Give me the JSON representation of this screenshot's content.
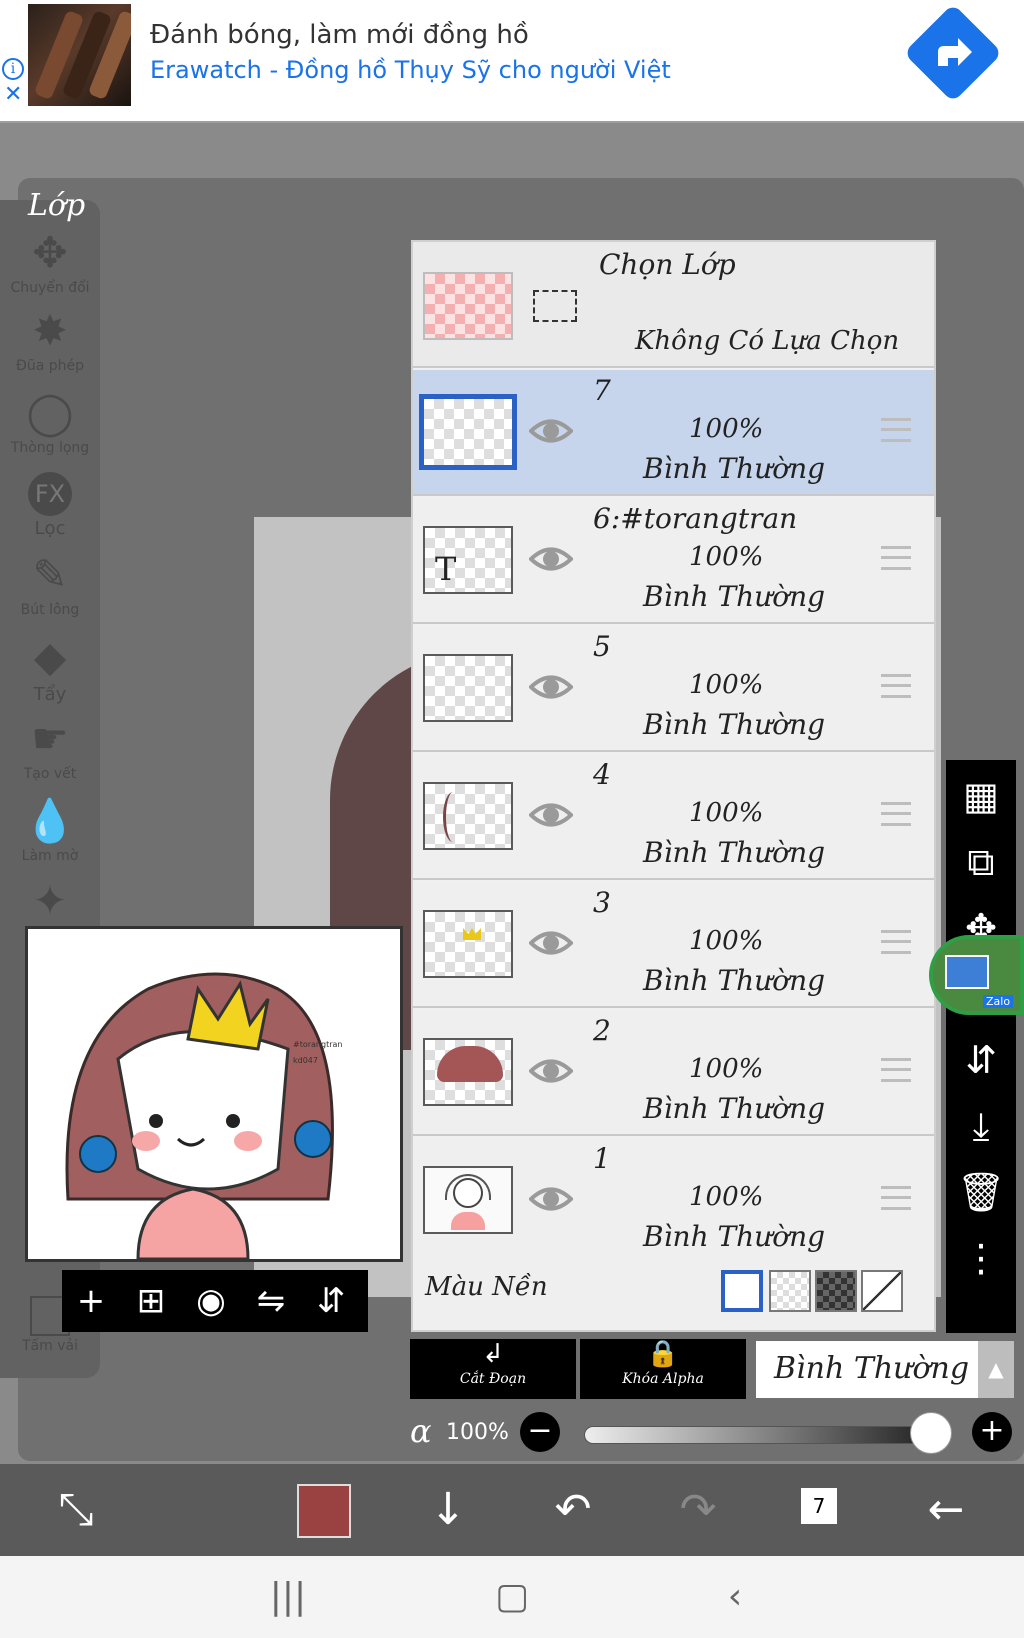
{
  "ad": {
    "title": "Đánh bóng, làm mới đồng hồ",
    "subtitle": "Erawatch - Đồng hồ Thụy Sỹ cho người Việt"
  },
  "toolbar": {
    "title": "Lớp",
    "tools": [
      {
        "label": "Chuyển đổi",
        "icon": "move-icon"
      },
      {
        "label": "Đũa phép",
        "icon": "magic-wand-icon"
      },
      {
        "label": "Thòng lọng",
        "icon": "lasso-icon"
      },
      {
        "label": "Lọc",
        "icon": "fx-icon"
      },
      {
        "label": "Bút lông",
        "icon": "brush-icon"
      },
      {
        "label": "Tẩy",
        "icon": "eraser-icon"
      },
      {
        "label": "Tạo vết",
        "icon": "smudge-icon"
      },
      {
        "label": "Làm mờ",
        "icon": "blur-icon"
      },
      {
        "label": "",
        "icon": "sparkle-icon"
      }
    ],
    "bottom_label": "Tấm vải"
  },
  "layers": {
    "selection": {
      "title": "Chọn Lớp",
      "subtitle": "Không Có Lựa Chọn"
    },
    "items": [
      {
        "name": "7",
        "opacity": "100%",
        "mode": "Bình Thường",
        "active": true,
        "thumb": "empty"
      },
      {
        "name": "6:#torangtran",
        "opacity": "100%",
        "mode": "Bình Thường",
        "active": false,
        "thumb": "text"
      },
      {
        "name": "5",
        "opacity": "100%",
        "mode": "Bình Thường",
        "active": false,
        "thumb": "empty"
      },
      {
        "name": "4",
        "opacity": "100%",
        "mode": "Bình Thường",
        "active": false,
        "thumb": "strand"
      },
      {
        "name": "3",
        "opacity": "100%",
        "mode": "Bình Thường",
        "active": false,
        "thumb": "crown"
      },
      {
        "name": "2",
        "opacity": "100%",
        "mode": "Bình Thường",
        "active": false,
        "thumb": "hair"
      },
      {
        "name": "1",
        "opacity": "100%",
        "mode": "Bình Thường",
        "active": false,
        "thumb": "full"
      }
    ],
    "background_label": "Màu Nền"
  },
  "actions": {
    "clip": "Cắt Đoạn",
    "alpha_lock": "Khóa Alpha",
    "blend_mode": "Bình Thường"
  },
  "opacity": {
    "symbol": "α",
    "value": "100%",
    "level": 1.0
  },
  "preview_text": {
    "line1": "#torangtran",
    "line2": "kd047"
  },
  "zalo_label": "Zalo",
  "bottombar": {
    "layer_count": "7",
    "color": "#9a4141"
  },
  "colors": {
    "accent": "#2b61c4",
    "active_row": "#c6d5ec",
    "ad_link": "#1a73e8"
  }
}
